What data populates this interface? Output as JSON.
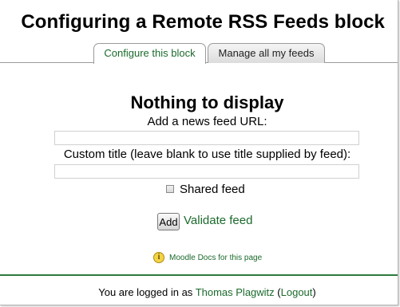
{
  "page": {
    "title": "Configuring a Remote RSS Feeds block"
  },
  "tabs": [
    {
      "label": "Configure this block",
      "active": true
    },
    {
      "label": "Manage all my feeds",
      "active": false
    }
  ],
  "main": {
    "heading": "Nothing to display",
    "url_label": "Add a news feed URL:",
    "url_value": "",
    "title_label": "Custom title (leave blank to use title supplied by feed):",
    "title_value": "",
    "shared_label": "Shared feed",
    "shared_checked": false,
    "add_button": "Add",
    "validate_link": "Validate feed"
  },
  "docs": {
    "icon": "info-icon",
    "link": "Moodle Docs for this page"
  },
  "footer": {
    "logged_in_prefix": "You are logged in as",
    "user_name": "Thomas Plagwitz",
    "logout_open": "(",
    "logout_label": "Logout",
    "logout_close": ")"
  },
  "colors": {
    "link": "#1b6a2c",
    "footer_rule": "#2d7a3c",
    "info_icon": "#f2d447"
  }
}
